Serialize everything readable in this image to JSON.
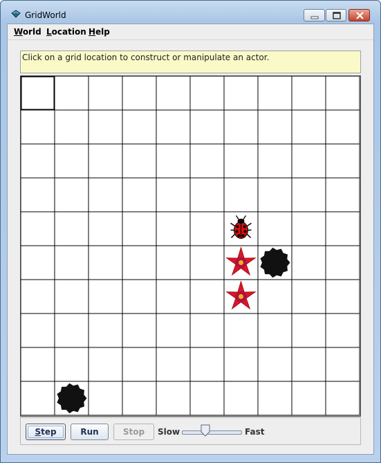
{
  "window": {
    "title": "GridWorld"
  },
  "menu": {
    "items": [
      {
        "key": "W",
        "rest": "orld"
      },
      {
        "key": "L",
        "rest": "ocation"
      },
      {
        "key": "H",
        "rest": "elp"
      }
    ]
  },
  "message": "Click on a grid location to construct or manipulate an actor.",
  "grid": {
    "rows": 10,
    "cols": 10,
    "selected": {
      "row": 0,
      "col": 0
    },
    "actors": [
      {
        "type": "bug",
        "row": 4,
        "col": 6,
        "color": "#d01010"
      },
      {
        "type": "flower",
        "row": 5,
        "col": 6,
        "color": "#d81828"
      },
      {
        "type": "rock",
        "row": 5,
        "col": 7,
        "color": "#111111"
      },
      {
        "type": "flower",
        "row": 6,
        "col": 6,
        "color": "#d81828"
      },
      {
        "type": "rock",
        "row": 9,
        "col": 1,
        "color": "#111111"
      }
    ]
  },
  "controls": {
    "step": {
      "key": "S",
      "rest": "tep"
    },
    "run": "Run",
    "stop": "Stop",
    "slow": "Slow",
    "fast": "Fast",
    "speed": 0.4
  }
}
